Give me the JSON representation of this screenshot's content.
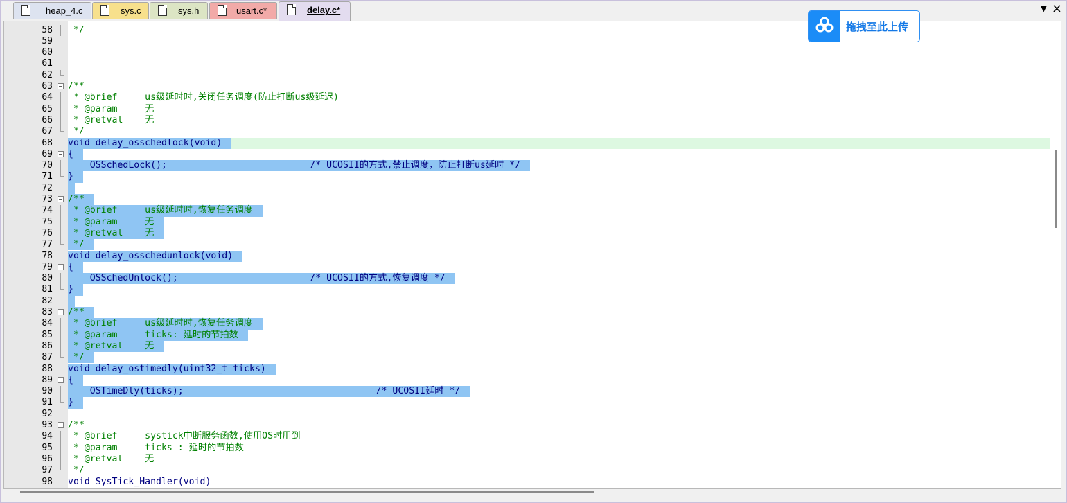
{
  "tabs": [
    {
      "label": "heap_4.c",
      "color": "#dde3f0",
      "active": false
    },
    {
      "label": "sys.c",
      "color": "#f7e08c",
      "active": false
    },
    {
      "label": "sys.h",
      "color": "#dce5c4",
      "active": false
    },
    {
      "label": "usart.c*",
      "color": "#f2aaa8",
      "active": false
    },
    {
      "label": "delay.c*",
      "color": "#e3dcef",
      "active": true
    }
  ],
  "tab_menu_arrow": "▼",
  "tab_close": "×",
  "upload": {
    "label": "拖拽至此上传",
    "icon": "cloud-icon"
  },
  "colors": {
    "selection": "#8fc5f3",
    "current_line": "#ddf8e1",
    "comment": "#008000",
    "keyword": "#000080"
  },
  "lines": [
    {
      "n": "58",
      "text": " */",
      "cls": "c-green"
    },
    {
      "n": "59",
      "text": ""
    },
    {
      "n": "60",
      "text": ""
    },
    {
      "n": "61",
      "text": ""
    },
    {
      "n": "62",
      "text": ""
    },
    {
      "n": "63",
      "text": "/**",
      "cls": "c-green"
    },
    {
      "n": "64",
      "text": " * @brief     us级延时时,关闭任务调度(防止打断us级延迟)",
      "cls": "c-green"
    },
    {
      "n": "65",
      "text": " * @param     无",
      "cls": "c-green"
    },
    {
      "n": "66",
      "text": " * @retval    无",
      "cls": "c-green"
    },
    {
      "n": "67",
      "text": " */",
      "cls": "c-green"
    },
    {
      "n": "68",
      "text": "void delay_osschedlock(void)",
      "cls": "c-navy"
    },
    {
      "n": "69",
      "text": "{",
      "cls": "c-navy"
    },
    {
      "n": "70",
      "text": "    OSSchedLock();                          /* UCOSII的方式,禁止调度，防止打断us延时 */",
      "cls": "c-navy"
    },
    {
      "n": "71",
      "text": "}",
      "cls": "c-navy"
    },
    {
      "n": "72",
      "text": ""
    },
    {
      "n": "73",
      "text": "/**",
      "cls": "c-green"
    },
    {
      "n": "74",
      "text": " * @brief     us级延时时,恢复任务调度",
      "cls": "c-green"
    },
    {
      "n": "75",
      "text": " * @param     无",
      "cls": "c-green"
    },
    {
      "n": "76",
      "text": " * @retval    无",
      "cls": "c-green"
    },
    {
      "n": "77",
      "text": " */",
      "cls": "c-green"
    },
    {
      "n": "78",
      "text": "void delay_osschedunlock(void)",
      "cls": "c-navy"
    },
    {
      "n": "79",
      "text": "{",
      "cls": "c-navy"
    },
    {
      "n": "80",
      "text": "    OSSchedUnlock();                        /* UCOSII的方式,恢复调度 */",
      "cls": "c-navy"
    },
    {
      "n": "81",
      "text": "}",
      "cls": "c-navy"
    },
    {
      "n": "82",
      "text": ""
    },
    {
      "n": "83",
      "text": "/**",
      "cls": "c-green"
    },
    {
      "n": "84",
      "text": " * @brief     us级延时时,恢复任务调度",
      "cls": "c-green"
    },
    {
      "n": "85",
      "text": " * @param     ticks: 延时的节拍数",
      "cls": "c-green"
    },
    {
      "n": "86",
      "text": " * @retval    无",
      "cls": "c-green"
    },
    {
      "n": "87",
      "text": " */",
      "cls": "c-green"
    },
    {
      "n": "88",
      "text": "void delay_ostimedly(uint32_t ticks)",
      "cls": "c-navy"
    },
    {
      "n": "89",
      "text": "{",
      "cls": "c-navy"
    },
    {
      "n": "90",
      "text": "    OSTimeDly(ticks);                                   /* UCOSII延时 */",
      "cls": "c-navy"
    },
    {
      "n": "91",
      "text": "}",
      "cls": "c-navy"
    },
    {
      "n": "92",
      "text": ""
    },
    {
      "n": "93",
      "text": "/**",
      "cls": "c-green"
    },
    {
      "n": "94",
      "text": " * @brief     systick中断服务函数,使用OS时用到",
      "cls": "c-green"
    },
    {
      "n": "95",
      "text": " * @param     ticks : 延时的节拍数",
      "cls": "c-green"
    },
    {
      "n": "96",
      "text": " * @retval    无",
      "cls": "c-green"
    },
    {
      "n": "97",
      "text": " */",
      "cls": "c-green"
    },
    {
      "n": "98",
      "text": "void SysTick_Handler(void)",
      "cls": "c-navy"
    }
  ]
}
